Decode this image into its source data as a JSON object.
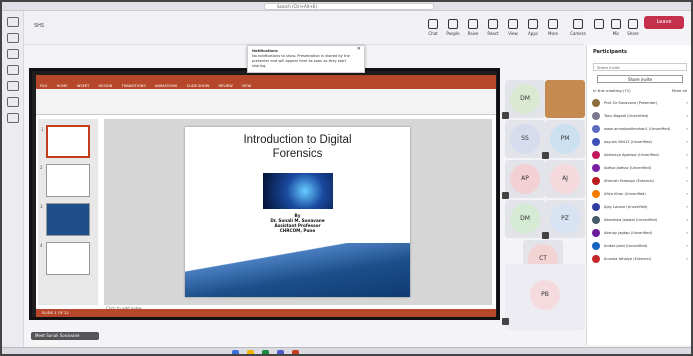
{
  "window": {
    "search_placeholder": "Search (Ctrl+Alt+E)"
  },
  "meeting": {
    "title": "SHS",
    "controls": [
      "Chat",
      "People",
      "Raise",
      "React",
      "View",
      "Apps",
      "More",
      "Camera",
      "Mic",
      "Share"
    ],
    "leave_label": "Leave"
  },
  "notification": {
    "title": "Notifications",
    "body": "No notifications to show. Presentation is shared by the presenter and will appear here as soon as they start sharing"
  },
  "powerpoint": {
    "menu": [
      "FILE",
      "HOME",
      "INSERT",
      "DESIGN",
      "TRANSITIONS",
      "ANIMATIONS",
      "SLIDE SHOW",
      "REVIEW",
      "VIEW"
    ],
    "slide": {
      "title_line1": "Introduction to Digital",
      "title_line2": "Forensics",
      "by": "By",
      "author": "Dr. Sonali M. Sonavane",
      "role": "Assistant Professor",
      "org": "CHRCOM, Pune"
    },
    "thumb_numbers": [
      "1",
      "2",
      "3",
      "4"
    ],
    "notes_hint": "Click to add notes",
    "status_text": "SLIDE 1 OF 21"
  },
  "share_label": "Meet Sonali Sonavane (Unverified)",
  "tiles": [
    {
      "initials": "DM",
      "color": "#dbe8d2"
    },
    {
      "initials": "SS",
      "color": "#d6dcee"
    },
    {
      "initials": "PM",
      "color": "#cce1ef"
    },
    {
      "initials": "AP",
      "color": "#f2d0d3"
    },
    {
      "initials": "AJ",
      "color": "#f6d9dc"
    },
    {
      "initials": "DM",
      "color": "#d5ead2"
    },
    {
      "initials": "PZ",
      "color": "#d7e3f3"
    },
    {
      "initials": "CT",
      "color": "#f4d3d5"
    },
    {
      "initials": "PB",
      "color": "#f6dbde"
    }
  ],
  "tile_pager": "1/3",
  "participants": {
    "title": "Participants",
    "invite_placeholder": "Share invite",
    "share_invite": "Share invite",
    "section": "In this meeting (71)",
    "mute_all": "Mute all",
    "people": [
      {
        "name": "Prof. Dr Sonavane (Presenter)",
        "color": "#8a6d3b"
      },
      {
        "name": "Tanu Bagadi (Unverified)",
        "color": "#7a7a8c"
      },
      {
        "name": "www anmolpatilmohan1 (Unverified)",
        "color": "#5c6bc0"
      },
      {
        "name": "aayush 08412 (Unverified)",
        "color": "#3f51b5"
      },
      {
        "name": "Abhinaya Agarwal (Unverified)",
        "color": "#c2185b"
      },
      {
        "name": "Aditya Jadhav (Unverified)",
        "color": "#7b1fa2"
      },
      {
        "name": "Afrenish Farooqui (External)",
        "color": "#b71c1c"
      },
      {
        "name": "Afiya Khan (Unverified)",
        "color": "#f57c00"
      },
      {
        "name": "Ajay Lonare (Unverified)",
        "color": "#303f9f"
      },
      {
        "name": "Akanksha Jaiswal (Unverified)",
        "color": "#455a64"
      },
      {
        "name": "Akshay Jagtap (Unverified)",
        "color": "#6a1b9a"
      },
      {
        "name": "Aniket Joshi (Unverified)",
        "color": "#1565c0"
      },
      {
        "name": "Anusha Athalye (External)",
        "color": "#c62828"
      }
    ]
  }
}
